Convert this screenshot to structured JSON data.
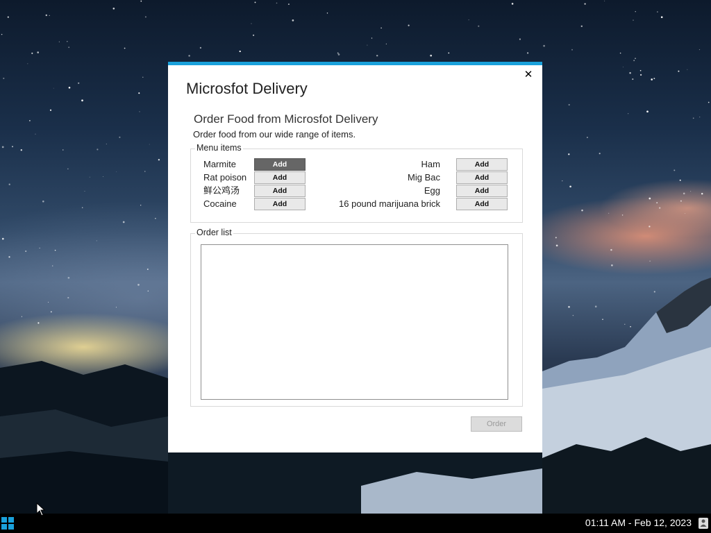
{
  "window": {
    "app_title": "Microsfot Delivery",
    "close_glyph": "✕",
    "accent_color": "#1aa1db"
  },
  "dialog": {
    "heading": "Order Food from Microsfot Delivery",
    "subheading": "Order food from our wide range of items."
  },
  "menu": {
    "legend": "Menu items",
    "add_label": "Add",
    "left_items": [
      {
        "label": "Marmite"
      },
      {
        "label": "Rat poison"
      },
      {
        "label": "鲜公鸡汤"
      },
      {
        "label": "Cocaine"
      }
    ],
    "right_items": [
      {
        "label": "Ham"
      },
      {
        "label": "Mig Bac"
      },
      {
        "label": "Egg"
      },
      {
        "label": "16 pound marijuana brick"
      }
    ]
  },
  "order_list": {
    "legend": "Order list",
    "items": []
  },
  "order_button": {
    "label": "Order",
    "enabled": false
  },
  "taskbar": {
    "clock": "01:11 AM - Feb 12, 2023",
    "start_icon": "windows-logo-icon",
    "tray_icon": "user-icon"
  }
}
